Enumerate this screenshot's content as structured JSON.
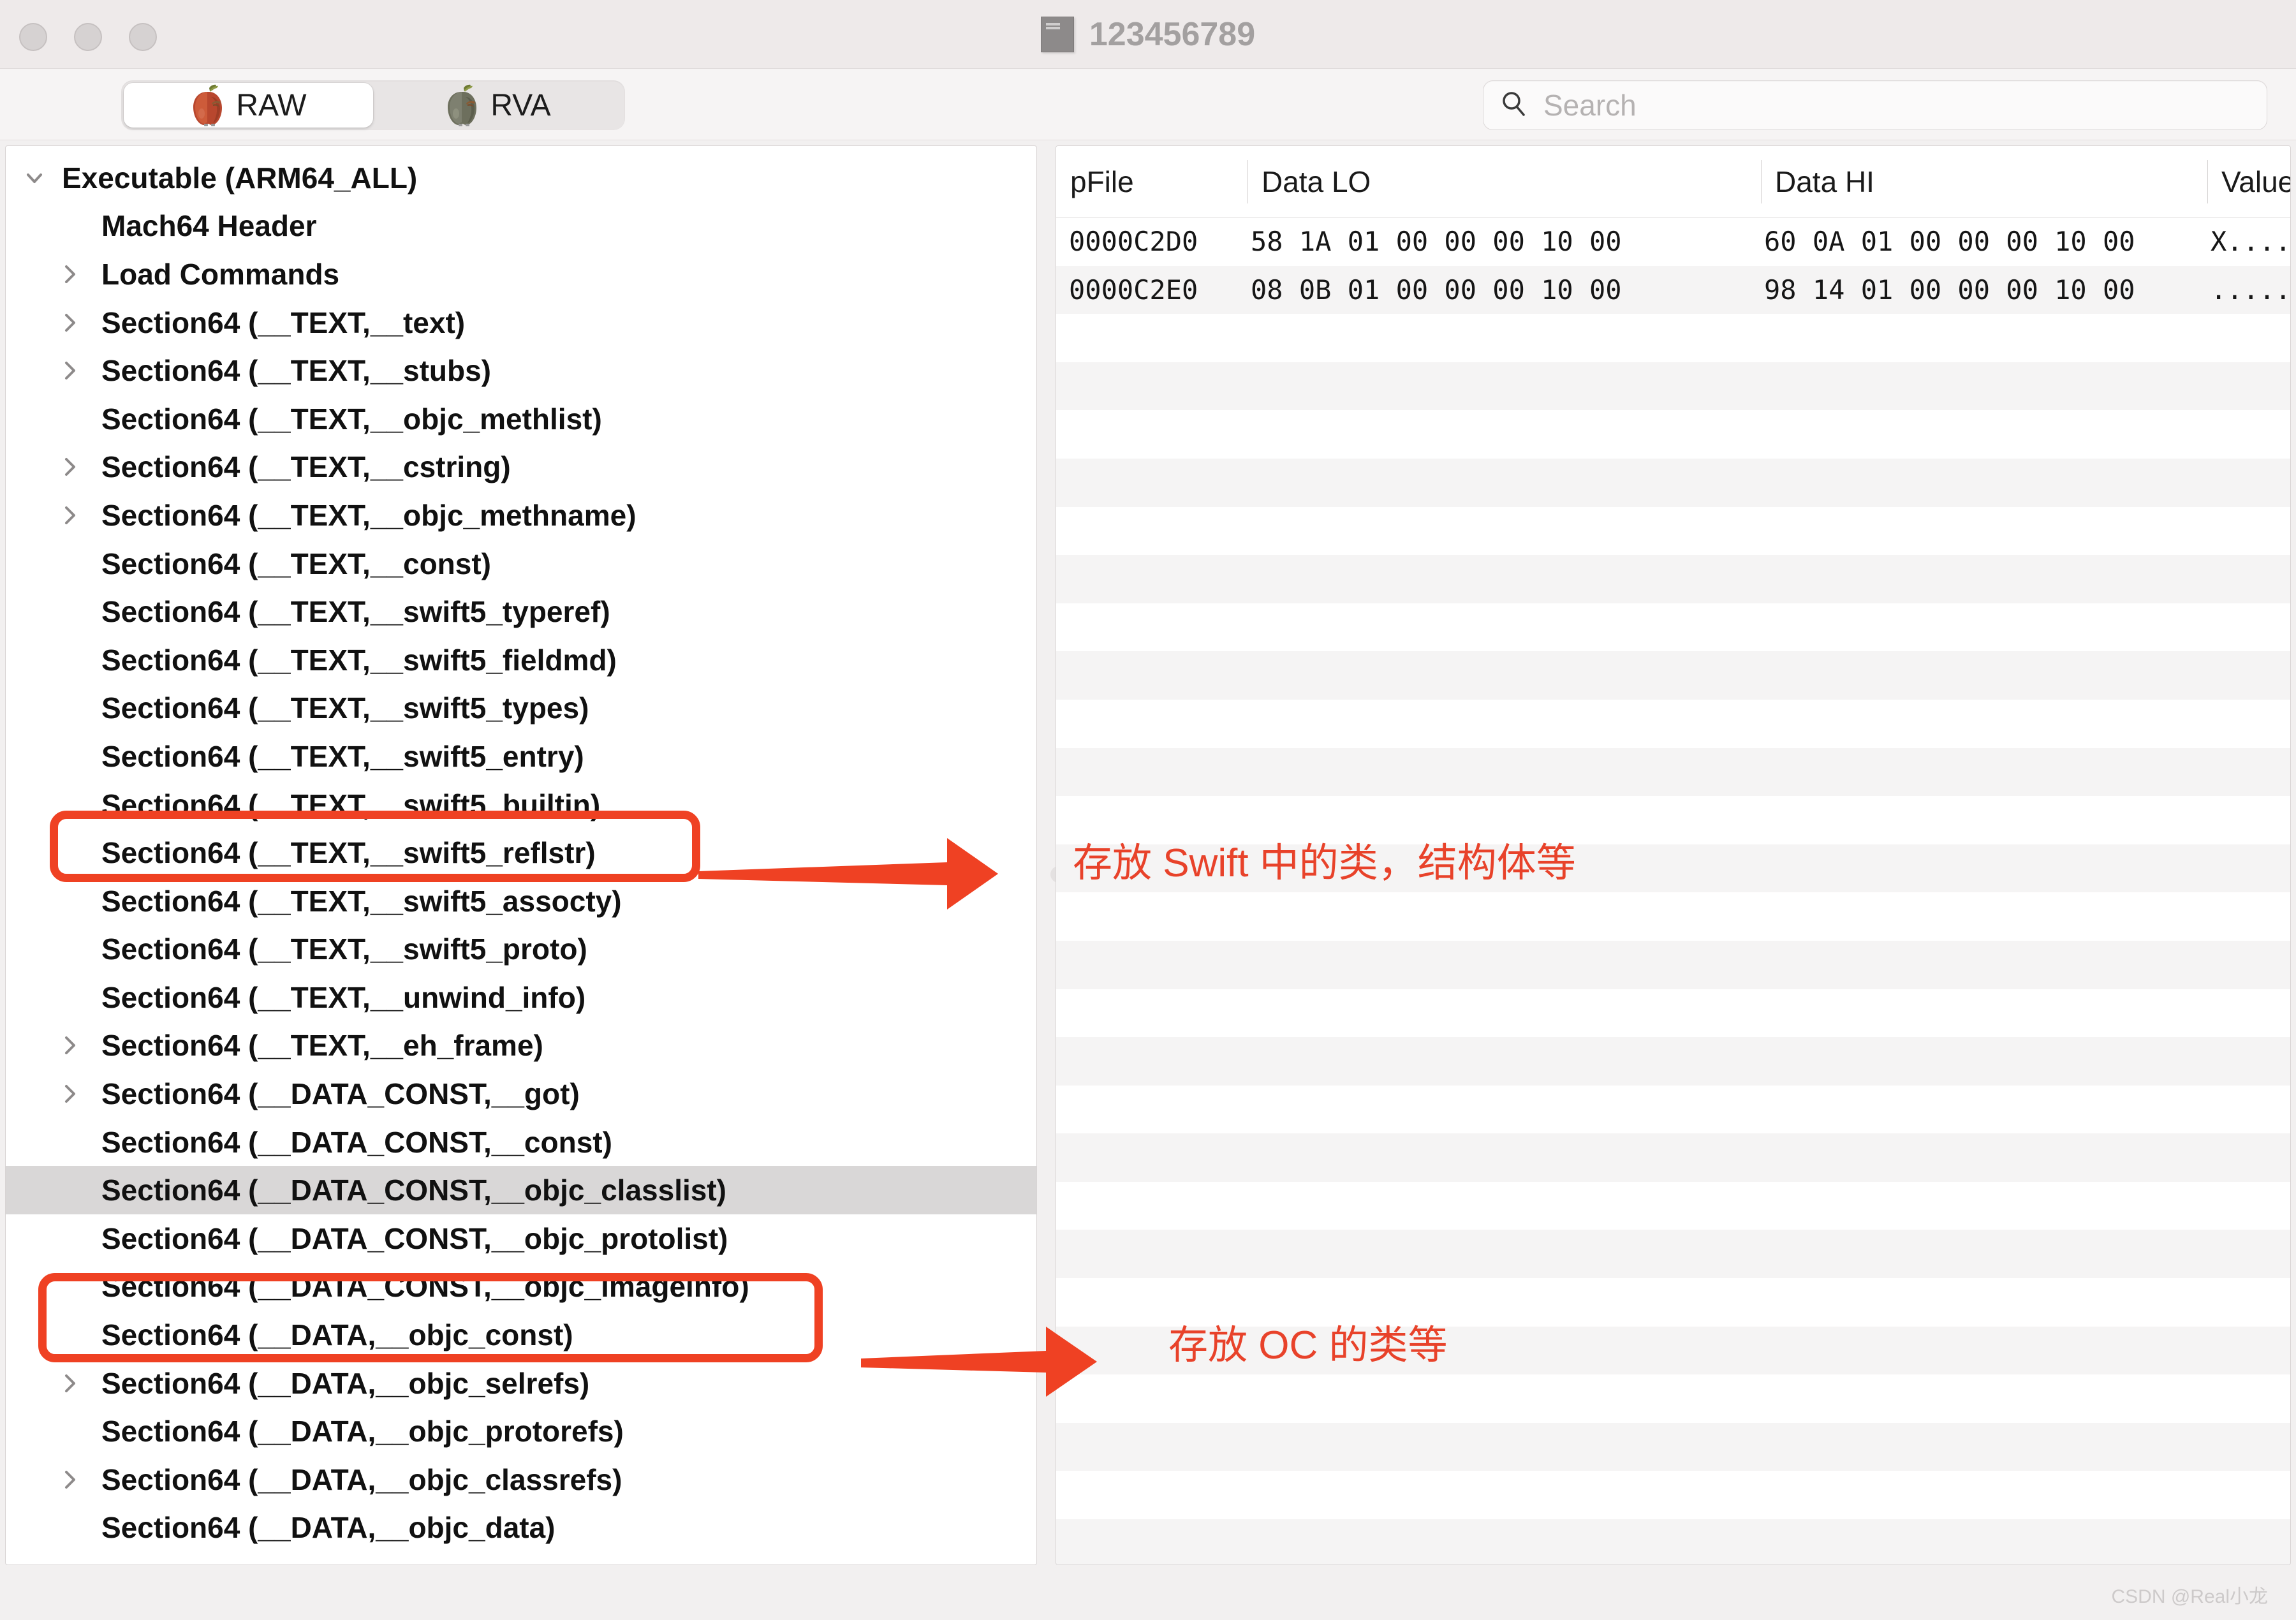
{
  "window": {
    "title": "123456789",
    "doc_icon": "document-icon",
    "traffic_lights": [
      "close-button",
      "minimize-button",
      "maximize-button"
    ]
  },
  "toolbar": {
    "segments": [
      {
        "label": "RAW",
        "icon": "red-apple-icon",
        "active": true
      },
      {
        "label": "RVA",
        "icon": "grey-apple-icon",
        "active": false
      }
    ],
    "search": {
      "icon": "search-icon",
      "value": "",
      "placeholder": "Search"
    }
  },
  "tree": {
    "items": [
      {
        "label": "Executable  (ARM64_ALL)",
        "depth": 0,
        "disclosure": "expanded",
        "selected": false
      },
      {
        "label": "Mach64 Header",
        "depth": 1,
        "disclosure": "none",
        "selected": false
      },
      {
        "label": "Load Commands",
        "depth": 1,
        "disclosure": "collapsed",
        "selected": false
      },
      {
        "label": "Section64 (__TEXT,__text)",
        "depth": 1,
        "disclosure": "collapsed",
        "selected": false
      },
      {
        "label": "Section64 (__TEXT,__stubs)",
        "depth": 1,
        "disclosure": "collapsed",
        "selected": false
      },
      {
        "label": "Section64 (__TEXT,__objc_methlist)",
        "depth": 1,
        "disclosure": "none",
        "selected": false
      },
      {
        "label": "Section64 (__TEXT,__cstring)",
        "depth": 1,
        "disclosure": "collapsed",
        "selected": false
      },
      {
        "label": "Section64 (__TEXT,__objc_methname)",
        "depth": 1,
        "disclosure": "collapsed",
        "selected": false
      },
      {
        "label": "Section64 (__TEXT,__const)",
        "depth": 1,
        "disclosure": "none",
        "selected": false
      },
      {
        "label": "Section64 (__TEXT,__swift5_typeref)",
        "depth": 1,
        "disclosure": "none",
        "selected": false
      },
      {
        "label": "Section64 (__TEXT,__swift5_fieldmd)",
        "depth": 1,
        "disclosure": "none",
        "selected": false
      },
      {
        "label": "Section64 (__TEXT,__swift5_types)",
        "depth": 1,
        "disclosure": "none",
        "selected": false
      },
      {
        "label": "Section64 (__TEXT,__swift5_entry)",
        "depth": 1,
        "disclosure": "none",
        "selected": false
      },
      {
        "label": "Section64 (__TEXT,__swift5_builtin)",
        "depth": 1,
        "disclosure": "none",
        "selected": false
      },
      {
        "label": "Section64 (__TEXT,__swift5_reflstr)",
        "depth": 1,
        "disclosure": "none",
        "selected": false
      },
      {
        "label": "Section64 (__TEXT,__swift5_assocty)",
        "depth": 1,
        "disclosure": "none",
        "selected": false
      },
      {
        "label": "Section64 (__TEXT,__swift5_proto)",
        "depth": 1,
        "disclosure": "none",
        "selected": false
      },
      {
        "label": "Section64 (__TEXT,__unwind_info)",
        "depth": 1,
        "disclosure": "none",
        "selected": false
      },
      {
        "label": "Section64 (__TEXT,__eh_frame)",
        "depth": 1,
        "disclosure": "collapsed",
        "selected": false
      },
      {
        "label": "Section64 (__DATA_CONST,__got)",
        "depth": 1,
        "disclosure": "collapsed",
        "selected": false
      },
      {
        "label": "Section64 (__DATA_CONST,__const)",
        "depth": 1,
        "disclosure": "none",
        "selected": false
      },
      {
        "label": "Section64 (__DATA_CONST,__objc_classlist)",
        "depth": 1,
        "disclosure": "none",
        "selected": true
      },
      {
        "label": "Section64 (__DATA_CONST,__objc_protolist)",
        "depth": 1,
        "disclosure": "none",
        "selected": false
      },
      {
        "label": "Section64 (__DATA_CONST,__objc_imageinfo)",
        "depth": 1,
        "disclosure": "none",
        "selected": false
      },
      {
        "label": "Section64 (__DATA,__objc_const)",
        "depth": 1,
        "disclosure": "none",
        "selected": false
      },
      {
        "label": "Section64 (__DATA,__objc_selrefs)",
        "depth": 1,
        "disclosure": "collapsed",
        "selected": false
      },
      {
        "label": "Section64 (__DATA,__objc_protorefs)",
        "depth": 1,
        "disclosure": "none",
        "selected": false
      },
      {
        "label": "Section64 (__DATA,__objc_classrefs)",
        "depth": 1,
        "disclosure": "collapsed",
        "selected": false
      },
      {
        "label": "Section64 (__DATA,__objc_data)",
        "depth": 1,
        "disclosure": "none",
        "selected": false
      }
    ]
  },
  "table": {
    "columns": [
      "pFile",
      "Data LO",
      "Data HI",
      "Value"
    ],
    "rows": [
      {
        "pFile": "0000C2D0",
        "data_lo": "58 1A 01 00 00 00 10 00",
        "data_hi": "60 0A 01 00 00 00 10 00",
        "value": "X...."
      },
      {
        "pFile": "0000C2E0",
        "data_lo": "08 0B 01 00 00 00 10 00",
        "data_hi": "98 14 01 00 00 00 10 00",
        "value": "....."
      }
    ],
    "empty_row_count": 27
  },
  "annotations": {
    "color": "#e8422a",
    "items": [
      {
        "text": "存放 Swift 中的类，结构体等",
        "target": "Section64 (__TEXT,__swift5_types)"
      },
      {
        "text": "存放 OC 的类等",
        "target": "Section64 (__DATA_CONST,__objc_classlist)"
      }
    ]
  },
  "watermark": {
    "text": "CSDN @Real小龙"
  }
}
